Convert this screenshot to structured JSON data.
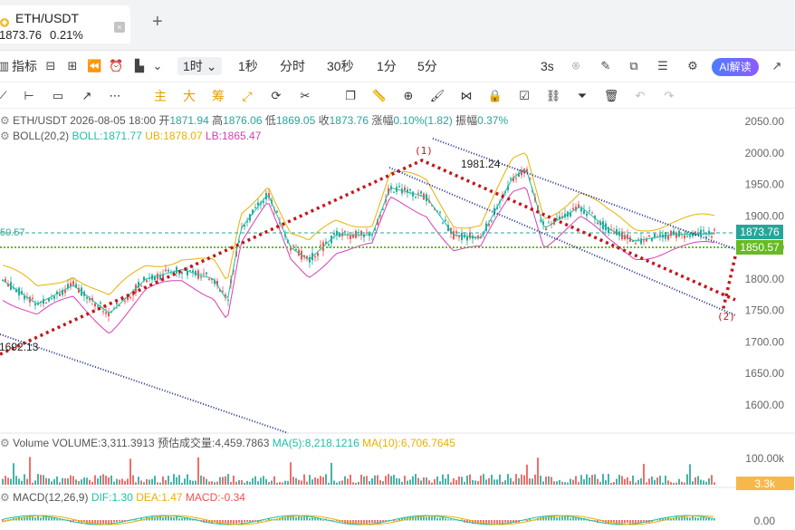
{
  "tab": {
    "symbol": "ETH/USDT",
    "price": "1873.76",
    "change": "0.21%",
    "close_glyph": "×",
    "add_glyph": "+"
  },
  "toolbar1": {
    "indicators_label": "指标",
    "intervals": [
      "1时",
      "1秒",
      "分时",
      "30秒",
      "1分",
      "5分"
    ],
    "selected_interval": "1时",
    "replay_label": "3s",
    "ai_label": "AI解读"
  },
  "toolbar2": {
    "cn_tools": [
      "主",
      "大",
      "筹"
    ]
  },
  "legend": {
    "ohlc_line": {
      "symbol": "ETH/USDT",
      "datetime": "2026-08-05 18:00",
      "open_label": "开",
      "open": "1871.94",
      "high_label": "高",
      "high": "1876.06",
      "low_label": "低",
      "low": "1869.05",
      "close_label": "收",
      "close": "1873.76",
      "chg_label": "涨幅",
      "chg": "0.10%(1.82)",
      "amp_label": "振幅",
      "amp": "0.37%"
    },
    "boll": {
      "name": "BOLL(20,2)",
      "mid": "BOLL:1871.77",
      "ub": "UB:1878.07",
      "lb": "LB:1865.47"
    },
    "volume": {
      "name": "Volume",
      "vol": "VOLUME:3,311.3913",
      "est": "预估成交量:4,459.7863",
      "ma5": "MA(5):8,218.1216",
      "ma10": "MA(10):6,706.7645"
    },
    "macd": {
      "name": "MACD(12,26,9)",
      "dif": "DIF:1.30",
      "dea": "DEA:1.47",
      "macd": "MACD:-0.34"
    }
  },
  "annotations": {
    "wave1": "(1)",
    "wave2": "(2)",
    "peak": "1981.24",
    "trough": "1692.13",
    "left_price": "50.57"
  },
  "axis": {
    "price_ticks": [
      "2050.00",
      "2000.00",
      "1950.00",
      "1900.00",
      "1850.00",
      "1800.00",
      "1750.00",
      "1700.00",
      "1650.00",
      "1600.00"
    ],
    "current_price": "1873.76",
    "line_price": "1850.57",
    "volume_tick": "100.00k",
    "volume_current": "3.3k",
    "macd_tick": "0.00"
  },
  "colors": {
    "up": "#26a69a",
    "down": "#ef5350",
    "boll_mid": "#1fbfa6",
    "boll_ub": "#e8b100",
    "boll_lb": "#d63fb5",
    "wave_red": "#c4161c",
    "channel_blue": "#1d2b8f",
    "ma5": "#1fbfa6",
    "ma10": "#e8b100",
    "accent": "#4d7cff"
  }
}
